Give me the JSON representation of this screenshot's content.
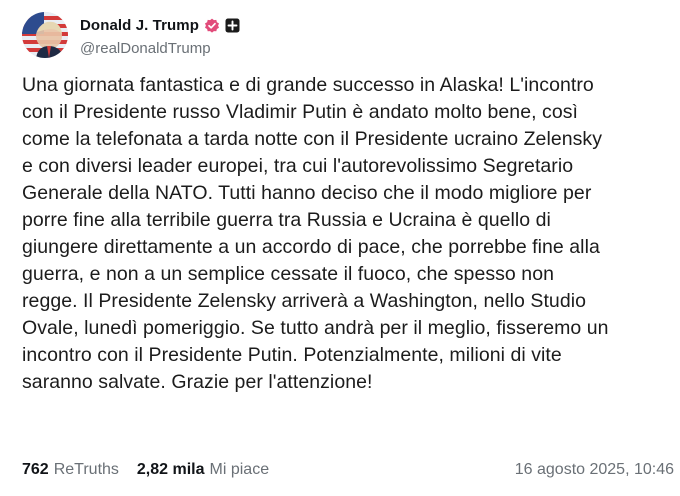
{
  "post": {
    "author": {
      "display_name": "Donald J. Trump",
      "handle": "@realDonaldTrump",
      "avatar_icon": "profile-avatar",
      "verified_icon": "verified-badge-icon",
      "extra_badge_icon": "plus-square-icon",
      "verified_color": "#e24b7a"
    },
    "body_lines": [
      "Una giornata fantastica e di grande successo in Alaska! L'incontro",
      "con il Presidente russo Vladimir Putin è andato molto bene, così",
      "come la telefonata a tarda notte con il Presidente ucraino Zelensky",
      "e con diversi leader europei, tra cui l'autorevolissimo Segretario",
      "Generale della NATO. Tutti hanno deciso che il modo migliore per",
      "porre fine alla terribile guerra tra Russia e Ucraina è quello di",
      "giungere direttamente a un accordo di pace, che porrebbe fine alla",
      "guerra, e non a un semplice cessate il fuoco, che spesso non",
      "regge. Il Presidente Zelensky arriverà a Washington, nello Studio",
      "Ovale, lunedì pomeriggio. Se tutto andrà per il meglio, fisseremo un",
      "incontro con il Presidente Putin. Potenzialmente, milioni di vite",
      "saranno salvate. Grazie per l'attenzione!"
    ],
    "stats": {
      "retruths_count": "762",
      "retruths_label": "ReTruths",
      "likes_count": "2,82 mila",
      "likes_label": "Mi piace"
    },
    "timestamp": "16 agosto 2025, 10:46"
  }
}
